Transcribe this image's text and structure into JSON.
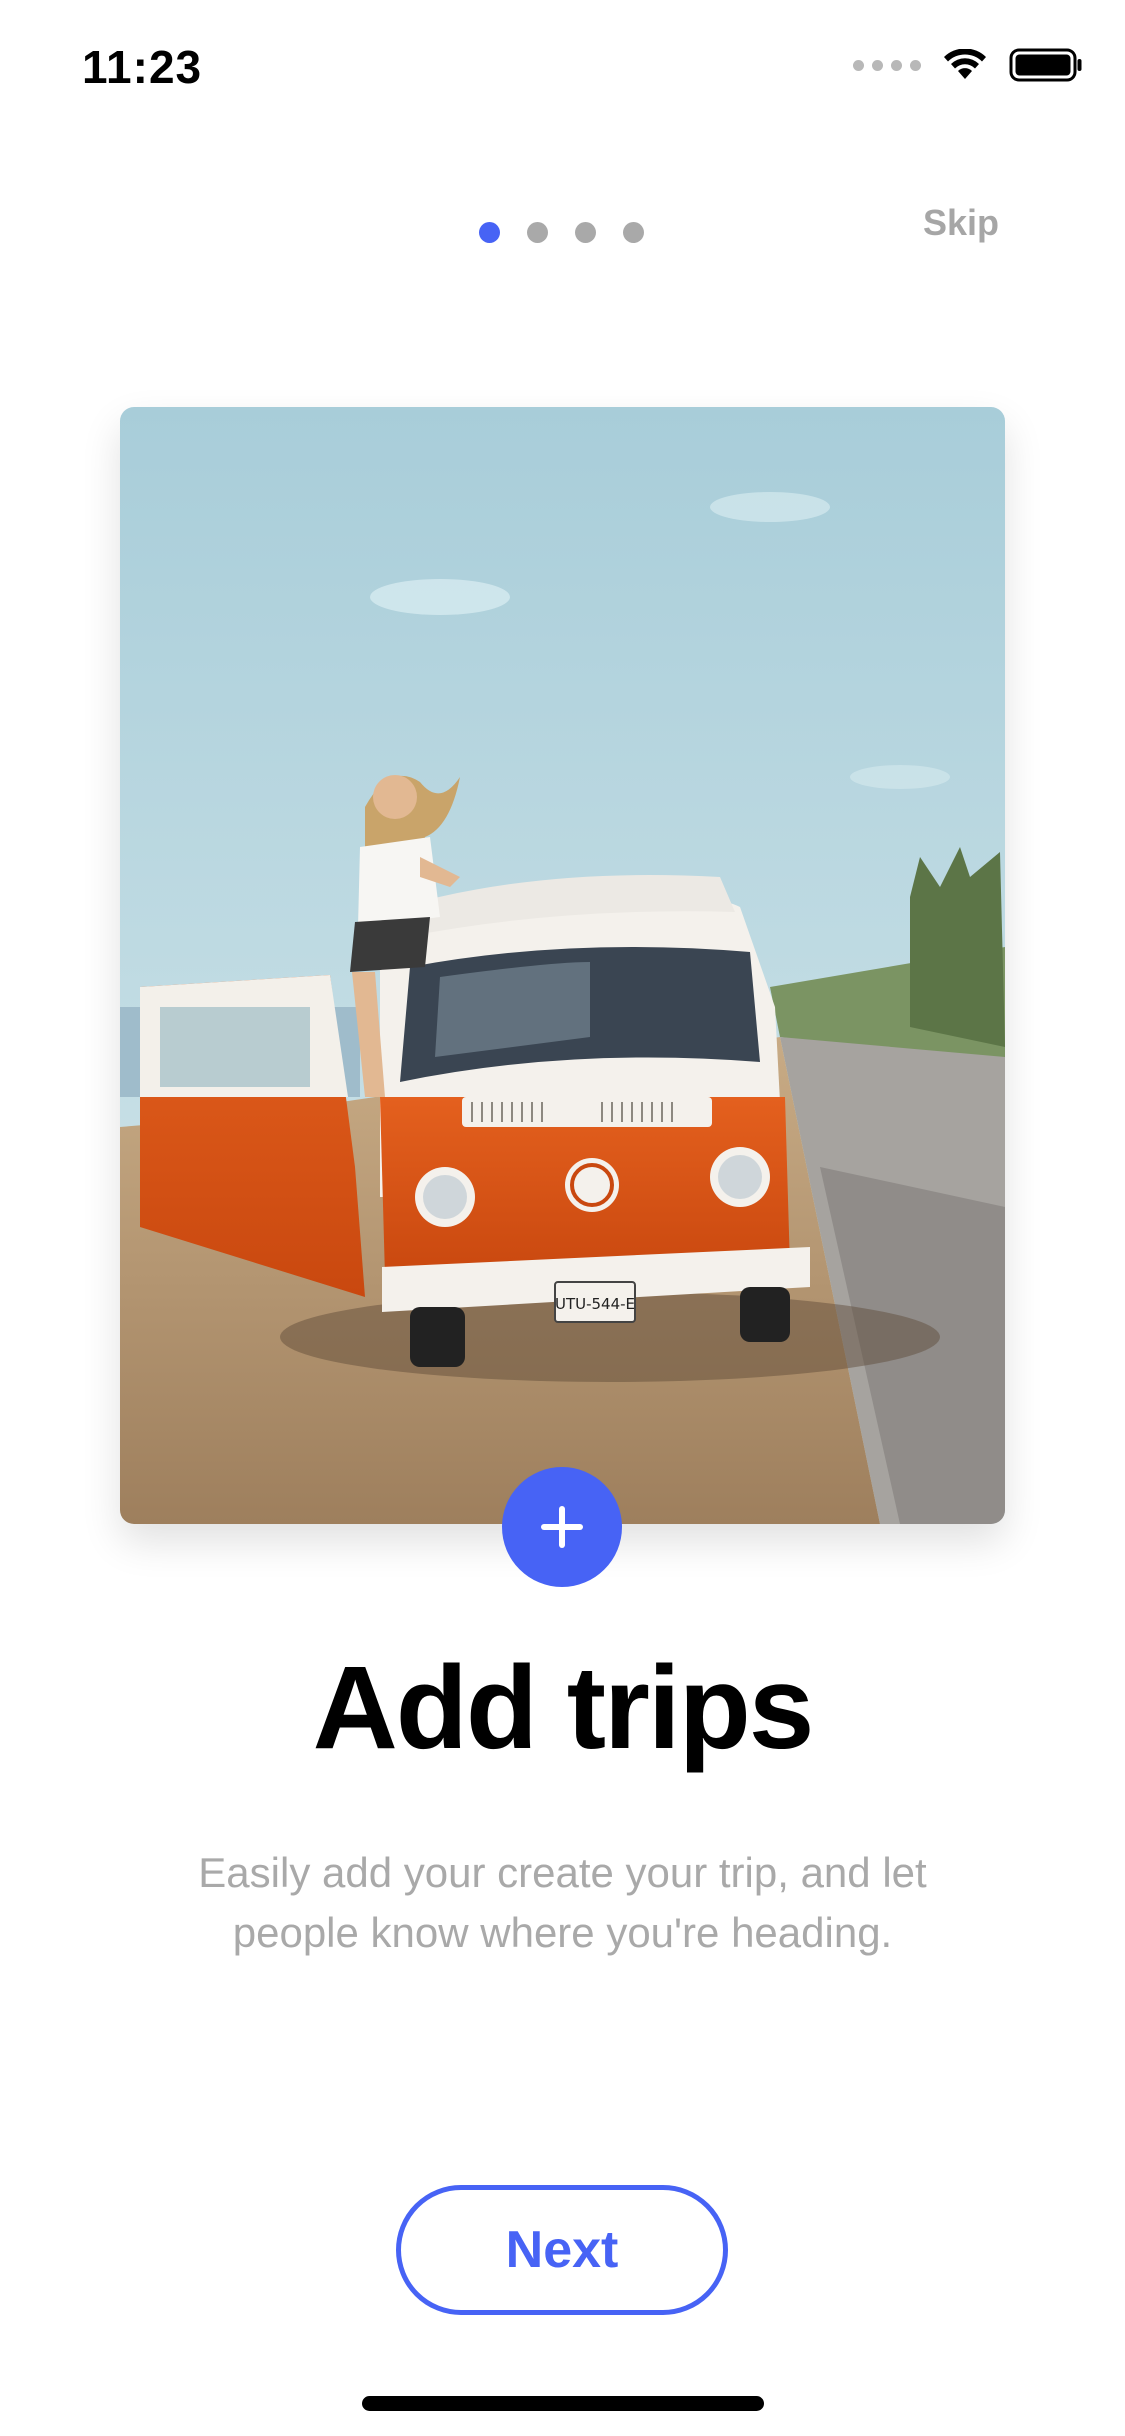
{
  "status_bar": {
    "time": "11:23"
  },
  "onboarding": {
    "page_count": 4,
    "active_page": 1,
    "skip_label": "Skip",
    "title": "Add trips",
    "description": "Easily add your create your trip, and let people know where you're heading.",
    "next_label": "Next"
  },
  "photo": {
    "license_plate": "UTU-544-E"
  },
  "colors": {
    "accent": "#4763f5",
    "muted_text": "#a9a9a9",
    "title_text": "#000000"
  },
  "icons": {
    "add": "plus-icon",
    "wifi": "wifi-icon",
    "battery": "battery-icon",
    "signal": "signal-icon"
  }
}
